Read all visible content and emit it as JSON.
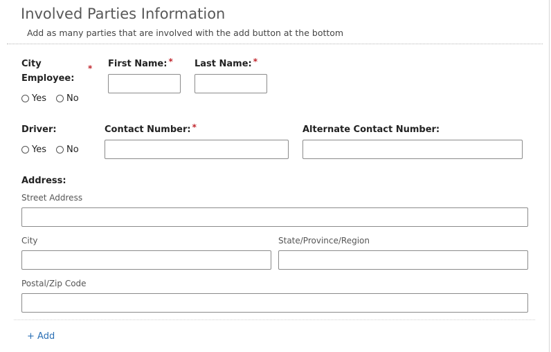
{
  "header": {
    "title": "Involved Parties Information",
    "subtitle": "Add as many parties that are involved with the add button at the bottom"
  },
  "required_marker": "*",
  "fields": {
    "city_employee": {
      "label_line1": "City",
      "label_line2": "Employee:",
      "options": [
        "Yes",
        "No"
      ]
    },
    "first_name": {
      "label": "First Name:",
      "value": ""
    },
    "last_name": {
      "label": "Last Name:",
      "value": ""
    },
    "driver": {
      "label": "Driver:",
      "options": [
        "Yes",
        "No"
      ]
    },
    "contact_number": {
      "label": "Contact Number:",
      "value": ""
    },
    "alternate_contact": {
      "label": "Alternate Contact Number:",
      "value": ""
    },
    "address": {
      "label": "Address:",
      "street": {
        "label": "Street Address",
        "value": ""
      },
      "city": {
        "label": "City",
        "value": ""
      },
      "state": {
        "label": "State/Province/Region",
        "value": ""
      },
      "postal": {
        "label": "Postal/Zip Code",
        "value": ""
      }
    }
  },
  "add_button": {
    "label": "+ Add"
  },
  "colors": {
    "required": "#c0262d",
    "link": "#2a6fb5",
    "title": "#585858"
  }
}
